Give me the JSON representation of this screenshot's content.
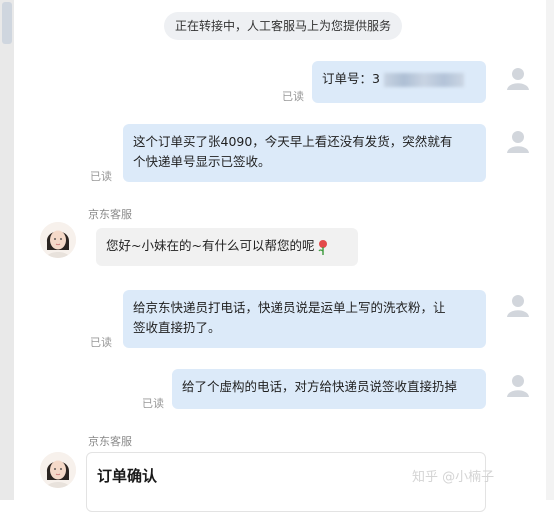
{
  "system_message": "正在转接中，人工客服马上为您提供服务",
  "read_label": "已读",
  "agent_name": "京东客服",
  "messages": {
    "m1": "订单号：",
    "m1_partial": "3",
    "m2_line1": "这个订单买了张4090，今天早上看还没有发货，突然就有",
    "m2_line2": "个快递单号显示已签收。",
    "m3": "您好~小妹在的~有什么可以帮您的呢",
    "m4_line1": "给京东快递员打电话，快递员说是运单上写的洗衣粉，让",
    "m4_line2": "签收直接扔了。",
    "m5": "给了个虚构的电话，对方给快递员说签收直接扔掉"
  },
  "card": {
    "title": "订单确认"
  },
  "watermark": "知乎 @小楠子",
  "colors": {
    "outgoing_bubble": "#dceaf9",
    "incoming_bubble": "#f1f1f1",
    "system_pill": "#eef0f3"
  }
}
